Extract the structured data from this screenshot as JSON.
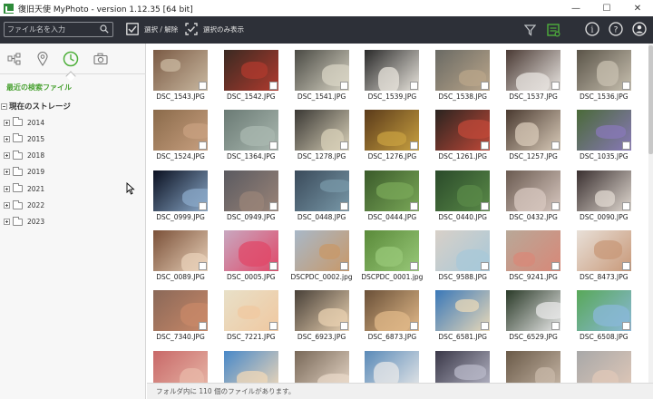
{
  "window": {
    "title": "復旧天使 MyPhoto - version 1.12.35 [64 bit]",
    "minimize_glyph": "—",
    "maximize_glyph": "☐",
    "close_glyph": "✕"
  },
  "toolbar": {
    "search_placeholder": "ファイル名を入力",
    "select_toggle_label": "選択 / 解除",
    "show_selected_label": "選択のみ表示",
    "info_glyph": "i",
    "help_glyph": "?",
    "account_glyph": "👤"
  },
  "sidebar": {
    "recent_label": "最近の検索ファイル",
    "storage_label": "現在のストレージ",
    "years": [
      "2014",
      "2015",
      "2018",
      "2019",
      "2021",
      "2022",
      "2023"
    ]
  },
  "photos": [
    {
      "name": "DSC_1543.JPG",
      "a": "#7a5a44",
      "b": "#c9b8a0"
    },
    {
      "name": "DSC_1542.JPG",
      "a": "#3a2a22",
      "b": "#b03a2e"
    },
    {
      "name": "DSC_1541.JPG",
      "a": "#4a4a44",
      "b": "#d8d4c4"
    },
    {
      "name": "DSC_1539.JPG",
      "a": "#2a2a2a",
      "b": "#e8e4dc"
    },
    {
      "name": "DSC_1538.JPG",
      "a": "#6a6a64",
      "b": "#b9a58a"
    },
    {
      "name": "DSC_1537.JPG",
      "a": "#4a3a34",
      "b": "#e8e4e0"
    },
    {
      "name": "DSC_1536.JPG",
      "a": "#5a5448",
      "b": "#c8c0b0"
    },
    {
      "name": "DSC_1524.JPG",
      "a": "#8a6a4a",
      "b": "#c8a080"
    },
    {
      "name": "DSC_1364.JPG",
      "a": "#6a7a74",
      "b": "#aab8b0"
    },
    {
      "name": "DSC_1278.JPG",
      "a": "#3a3834",
      "b": "#d8d0b8"
    },
    {
      "name": "DSC_1276.JPG",
      "a": "#5a3a1a",
      "b": "#c8a040"
    },
    {
      "name": "DSC_1261.JPG",
      "a": "#2a2420",
      "b": "#c04838"
    },
    {
      "name": "DSC_1257.JPG",
      "a": "#4a3a30",
      "b": "#d8cab8"
    },
    {
      "name": "DSC_1035.JPG",
      "a": "#4a6a38",
      "b": "#8878b8"
    },
    {
      "name": "DSC_0999.JPG",
      "a": "#0a1020",
      "b": "#8aa8c8"
    },
    {
      "name": "DSC_0949.JPG",
      "a": "#5a5a60",
      "b": "#9a8478"
    },
    {
      "name": "DSC_0448.JPG",
      "a": "#3a4a5a",
      "b": "#7898a8"
    },
    {
      "name": "DSC_0444.JPG",
      "a": "#3a5a2a",
      "b": "#7aa858"
    },
    {
      "name": "DSC_0440.JPG",
      "a": "#2a4a2a",
      "b": "#5a8a48"
    },
    {
      "name": "DSC_0432.JPG",
      "a": "#6a5a50",
      "b": "#d8c8c0"
    },
    {
      "name": "DSC_0090.JPG",
      "a": "#3a3030",
      "b": "#e0d8d0"
    },
    {
      "name": "DSC_0089.JPG",
      "a": "#7a5038",
      "b": "#e8d0b8"
    },
    {
      "name": "DSC_0005.JPG",
      "a": "#c8a8c0",
      "b": "#e04868"
    },
    {
      "name": "DSCPDC_0002.jpg",
      "a": "#a8b8c8",
      "b": "#c89868"
    },
    {
      "name": "DSCPDC_0001.jpg",
      "a": "#5a8a3a",
      "b": "#98c878"
    },
    {
      "name": "DSC_9588.JPG",
      "a": "#d8d0c8",
      "b": "#a8c8d8"
    },
    {
      "name": "DSC_9241.JPG",
      "a": "#b8a898",
      "b": "#d88878"
    },
    {
      "name": "DSC_8473.JPG",
      "a": "#e8e0d8",
      "b": "#c89878"
    },
    {
      "name": "DSC_7340.JPG",
      "a": "#8a6858",
      "b": "#c88868"
    },
    {
      "name": "DSC_7221.JPG",
      "a": "#e8e0c8",
      "b": "#f0c8a0"
    },
    {
      "name": "DSC_6923.JPG",
      "a": "#484038",
      "b": "#e8d0b0"
    },
    {
      "name": "DSC_6873.JPG",
      "a": "#6a5038",
      "b": "#e0b888"
    },
    {
      "name": "DSC_6581.JPG",
      "a": "#3a78b8",
      "b": "#e8d8b8"
    },
    {
      "name": "DSC_6529.JPG",
      "a": "#2a3a28",
      "b": "#e8e8e8"
    },
    {
      "name": "DSC_6508.JPG",
      "a": "#58a858",
      "b": "#8ab8d8"
    },
    {
      "name": "",
      "a": "#c86868",
      "b": "#e8b8a8"
    },
    {
      "name": "",
      "a": "#4888c8",
      "b": "#f0d8b8"
    },
    {
      "name": "",
      "a": "#786858",
      "b": "#e8d8c8"
    },
    {
      "name": "",
      "a": "#5a8ab8",
      "b": "#e8e8e8"
    },
    {
      "name": "",
      "a": "#3a3848",
      "b": "#b8b8c8"
    },
    {
      "name": "",
      "a": "#6a5a48",
      "b": "#c8b8a8"
    },
    {
      "name": "",
      "a": "#a8a8a8",
      "b": "#e0c8b8"
    }
  ],
  "status": {
    "text": "フォルダ内に 110 個のファイルがあります。"
  }
}
